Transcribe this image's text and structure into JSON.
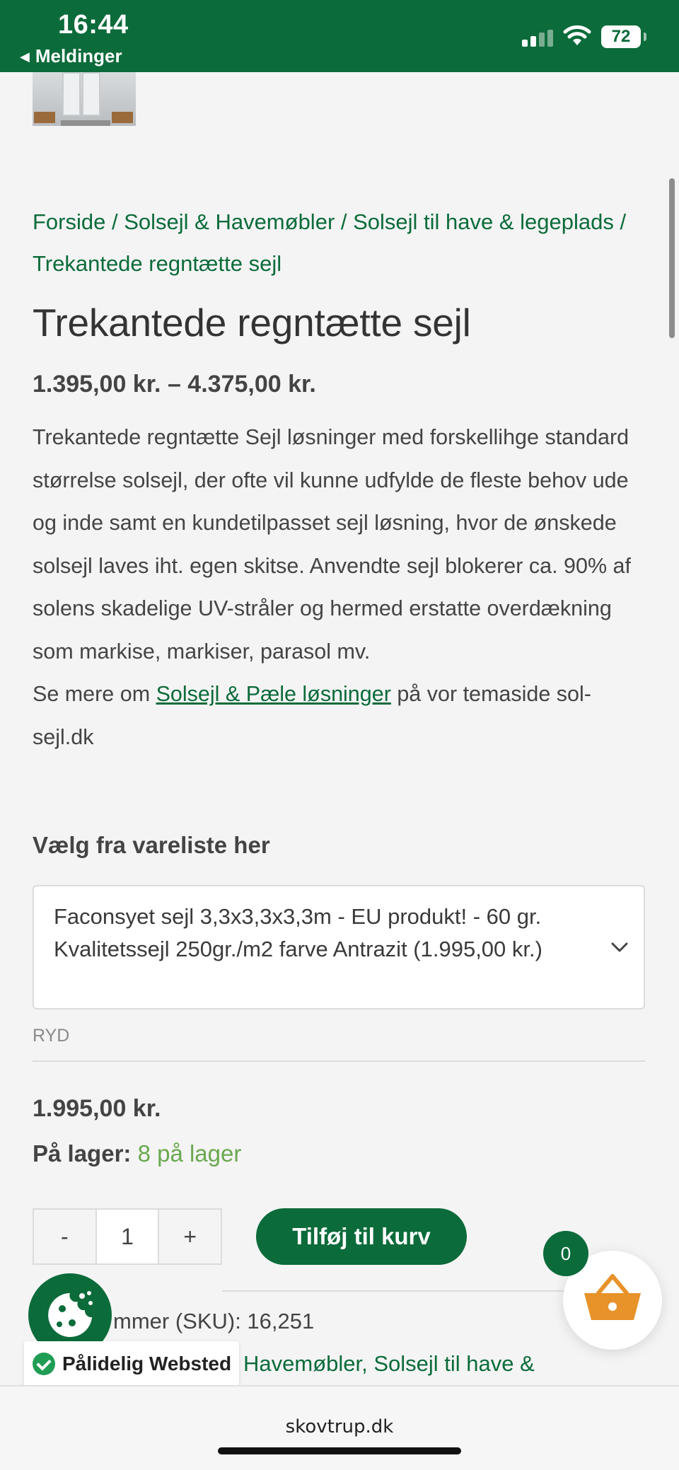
{
  "status_bar": {
    "time": "16:44",
    "back_label": "Meldinger",
    "battery": "72"
  },
  "breadcrumb": {
    "items": [
      "Forside",
      "Solsejl & Havemøbler",
      "Solsejl til have & legeplads",
      "Trekantede regntætte sejl"
    ],
    "separator": " / "
  },
  "product": {
    "title": "Trekantede regntætte sejl",
    "price_range": "1.395,00 kr. – 4.375,00 kr.",
    "description_main": "Trekantede regntætte Sejl løsninger med forskellihge standard størrelse solsejl, der ofte vil kunne udfylde de fleste behov ude og inde samt en kundetilpasset sejl løsning, hvor de ønskede solsejl laves iht. egen skitse. Anvendte sejl blokerer ca. 90% af solens skadelige UV-stråler og hermed erstatte overdækning som markise, markiser, parasol mv.",
    "description_more_prefix": "Se mere om ",
    "description_more_link": "Solsejl & Pæle løsninger",
    "description_more_suffix": " på vor temaside sol-sejl.dk",
    "select_label": "Vælg fra vareliste her",
    "selected_variant": "Faconsyet sejl 3,3x3,3x3,3m - EU produkt! - 60 gr. Kvalitetssejl 250gr./m2 farve Antrazit (1.995,00 kr.)",
    "reset_label": "RYD",
    "price": "1.995,00 kr.",
    "stock_label": "På lager:",
    "stock_value": "8 på lager",
    "qty_minus": "-",
    "qty_value": "1",
    "qty_plus": "+",
    "add_to_cart": "Tilføj til kurv",
    "sku_text": "mmer (SKU): 16,251",
    "categories_text": "Havemøbler, Solsejl til have &"
  },
  "floating": {
    "cart_count": "0",
    "trust_badge": "Pålidelig Websted"
  },
  "browser": {
    "url": "skovtrup.dk"
  },
  "colors": {
    "brand_green": "#0b6b3a",
    "stock_green": "#6aa84f",
    "cart_orange": "#e8922a"
  }
}
